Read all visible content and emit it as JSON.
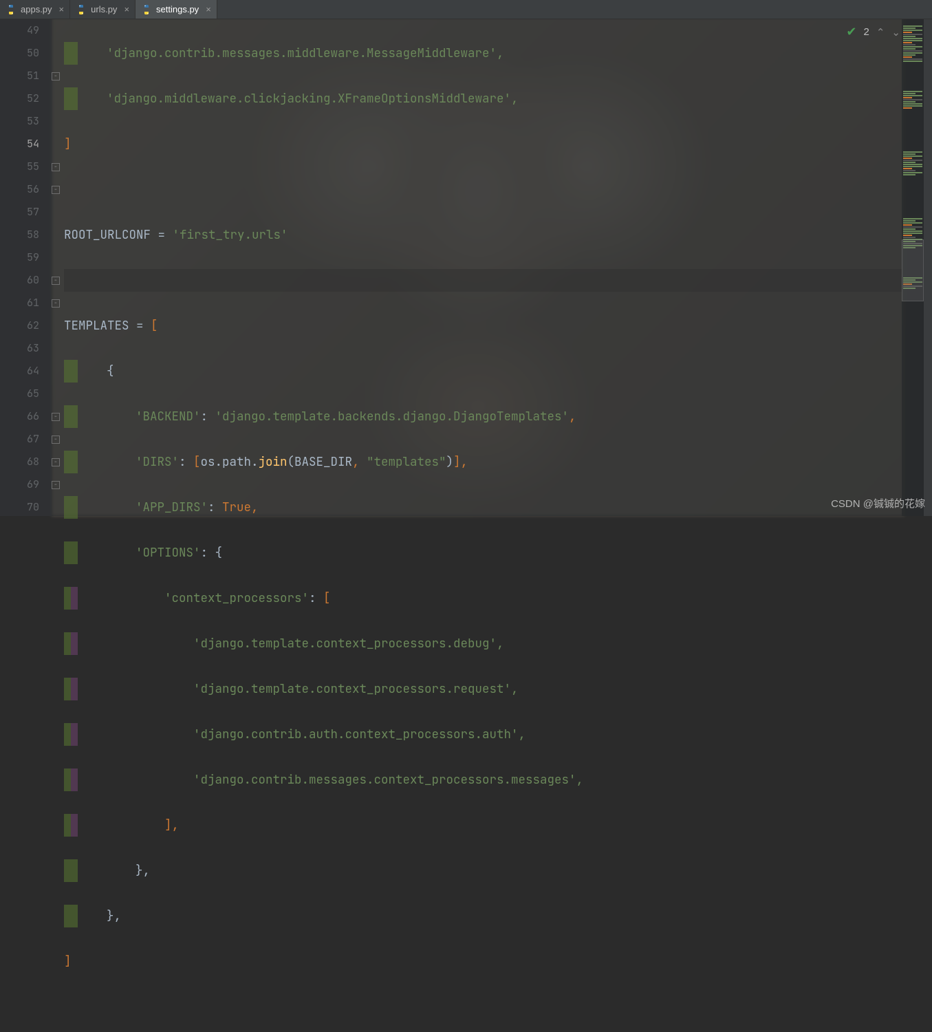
{
  "tabs": [
    {
      "label": "apps.py",
      "active": false
    },
    {
      "label": "urls.py",
      "active": false
    },
    {
      "label": "settings.py",
      "active": true
    }
  ],
  "status": {
    "count": "2"
  },
  "gutter": {
    "start": 49,
    "end": 70,
    "current": 54
  },
  "code": {
    "l49": "'django.contrib.messages.middleware.MessageMiddleware',",
    "l50": "'django.middleware.clickjacking.XFrameOptionsMiddleware',",
    "l51": "]",
    "l52": "",
    "l53_root": "ROOT_URLCONF",
    "l53_eq": " = ",
    "l53_val": "'first_try.urls'",
    "l54": "",
    "l55_tmpl": "TEMPLATES",
    "l55_eq": " = ",
    "l55_br": "[",
    "l56": "{",
    "l57_k": "'BACKEND'",
    "l57_c": ": ",
    "l57_v": "'django.template.backends.django.DjangoTemplates'",
    "l57_e": ",",
    "l58_k": "'DIRS'",
    "l58_c": ": ",
    "l58_b1": "[",
    "l58_os": "os",
    "l58_d1": ".",
    "l58_path": "path",
    "l58_d2": ".",
    "l58_join": "join",
    "l58_p1": "(",
    "l58_base": "BASE_DIR",
    "l58_cm": ", ",
    "l58_tpl": "\"templates\"",
    "l58_p2": ")",
    "l58_b2": "]",
    "l58_e": ",",
    "l59_k": "'APP_DIRS'",
    "l59_c": ": ",
    "l59_v": "True",
    "l59_e": ",",
    "l60_k": "'OPTIONS'",
    "l60_c": ": ",
    "l60_v": "{",
    "l61_k": "'context_processors'",
    "l61_c": ": ",
    "l61_v": "[",
    "l62": "'django.template.context_processors.debug',",
    "l63": "'django.template.context_processors.request',",
    "l64": "'django.contrib.auth.context_processors.auth',",
    "l65": "'django.contrib.messages.context_processors.messages',",
    "l66": "],",
    "l67": "},",
    "l68": "},",
    "l69": "]"
  },
  "watermark": "CSDN @铖铖的花嫁"
}
